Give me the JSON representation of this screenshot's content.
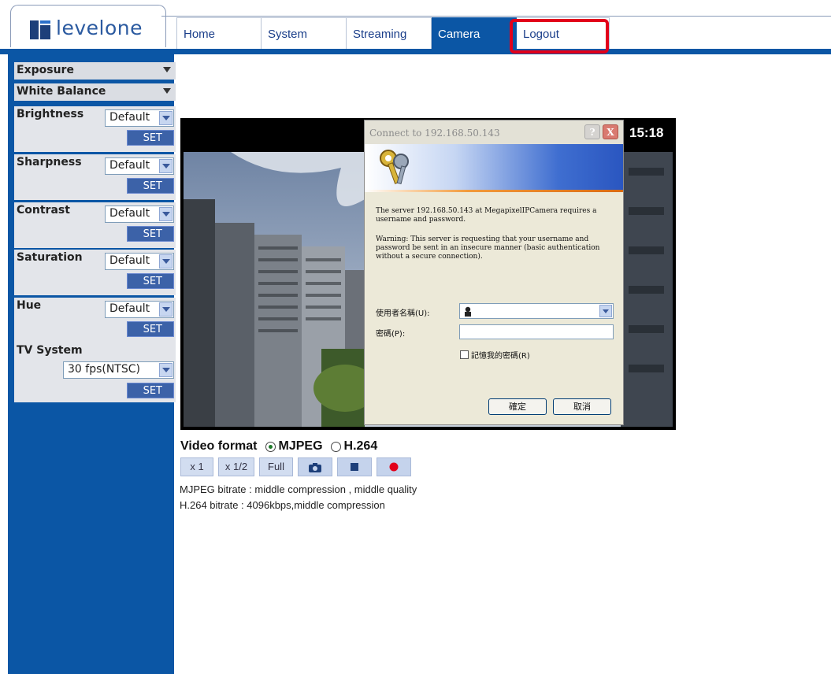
{
  "logo": {
    "text_light": "level",
    "text_dark": "one"
  },
  "nav": {
    "tabs": [
      {
        "label": "Home",
        "active": false
      },
      {
        "label": "System",
        "active": false
      },
      {
        "label": "Streaming",
        "active": false
      },
      {
        "label": "Camera",
        "active": true
      },
      {
        "label": "Logout",
        "active": false,
        "highlighted": true
      }
    ]
  },
  "sidebar": {
    "exposure": "Exposure",
    "white_balance": "White Balance",
    "panels": [
      {
        "label": "Brightness",
        "value": "Default",
        "set": "SET"
      },
      {
        "label": "Sharpness",
        "value": "Default",
        "set": "SET"
      },
      {
        "label": "Contrast",
        "value": "Default",
        "set": "SET"
      },
      {
        "label": "Saturation",
        "value": "Default",
        "set": "SET"
      },
      {
        "label": "Hue",
        "value": "Default",
        "set": "SET"
      }
    ],
    "tv_system": {
      "label": "TV System",
      "value": "30 fps(NTSC)",
      "set": "SET"
    }
  },
  "video": {
    "clock": "15:18"
  },
  "dialog": {
    "title": "Connect to 192.168.50.143",
    "help": "?",
    "close": "X",
    "message": "The server 192.168.50.143 at MegapixelIPCamera requires a username and password.",
    "warning": "Warning: This server is requesting that your username and password be sent in an insecure manner (basic authentication without a secure connection).",
    "username_label": "使用者名稱(U):",
    "password_label": "密碼(P):",
    "remember_label": "記憶我的密碼(R)",
    "ok": "確定",
    "cancel": "取消"
  },
  "controls": {
    "video_format_label": "Video format",
    "mjpeg": "MJPEG",
    "h264": "H.264",
    "selected": "MJPEG",
    "x1": "x 1",
    "x_half": "x 1/2",
    "full": "Full",
    "mjpeg_bitrate": "MJPEG bitrate : middle compression , middle quality",
    "h264_bitrate": "H.264 bitrate : 4096kbps,middle compression"
  },
  "colors": {
    "brand_blue": "#0b56a5",
    "highlight_red": "#e2001a",
    "record_red": "#e2001a"
  }
}
